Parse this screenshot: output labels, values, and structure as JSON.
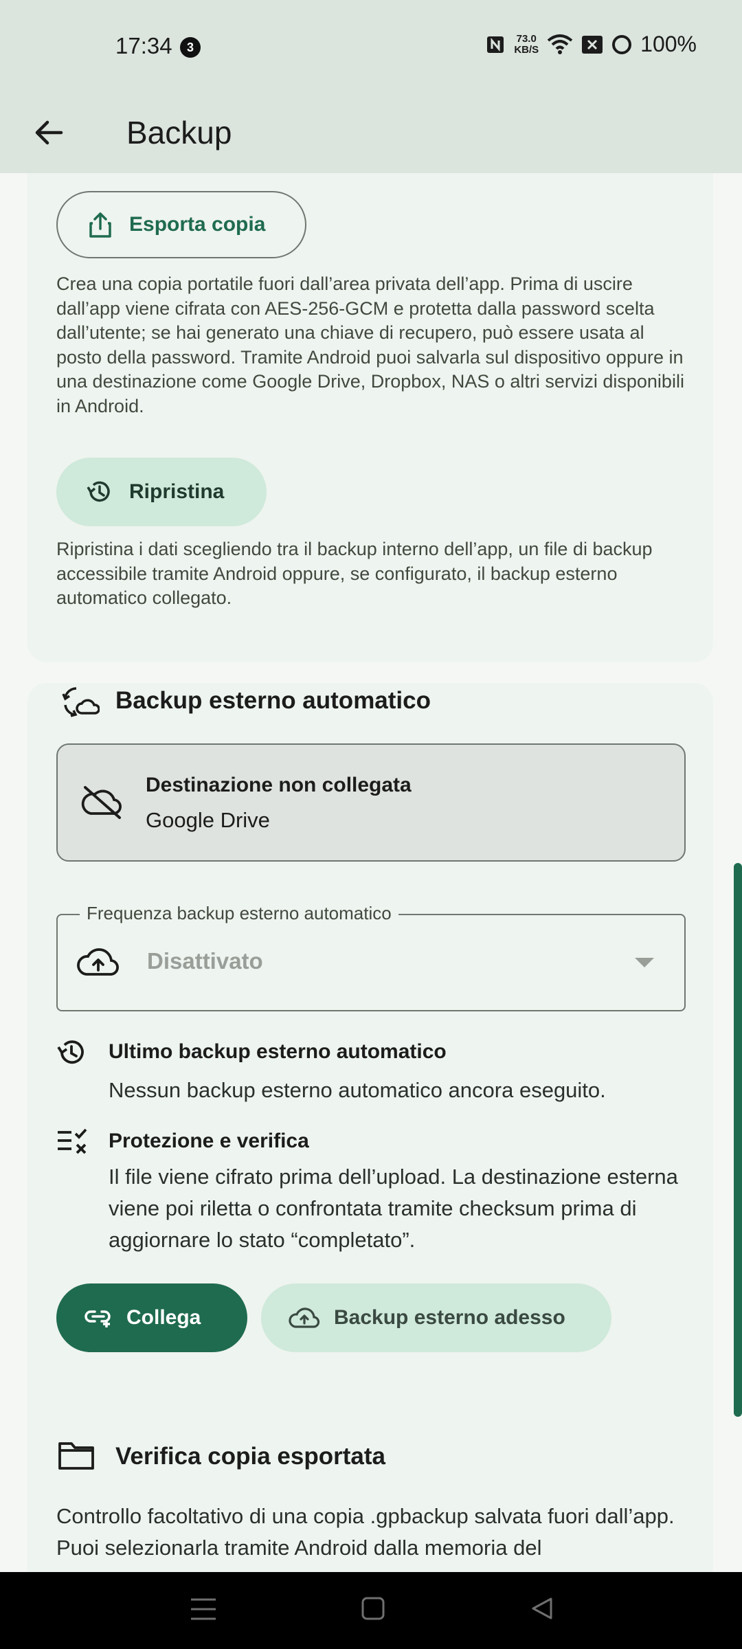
{
  "status_bar": {
    "time": "17:34",
    "notification_count": "3",
    "net_speed_value": "73.0",
    "net_speed_unit": "KB/S",
    "battery": "100%"
  },
  "app_bar": {
    "title": "Backup"
  },
  "export_section": {
    "button_label": "Esporta copia",
    "description": "Crea una copia portatile fuori dall’area privata dell’app. Prima di uscire dall’app viene cifrata con AES-256-GCM e protetta dalla password scelta dall’utente; se hai generato una chiave di recupero, può essere usata al posto della password. Tramite Android puoi salvarla sul dispositivo oppure in una destinazione come Google Drive, Dropbox, NAS o altri servizi disponibili in Android.",
    "restore_button_label": "Ripristina",
    "restore_description": "Ripristina i dati scegliendo tra il backup interno dell’app, un file di backup accessibile tramite Android oppure, se configurato, il backup esterno automatico collegato."
  },
  "auto_backup_section": {
    "title": "Backup esterno automatico",
    "destination_title": "Destinazione non collegata",
    "destination_service": "Google Drive",
    "frequency_label": "Frequenza backup esterno automatico",
    "frequency_value": "Disattivato",
    "last_backup_title": "Ultimo backup esterno automatico",
    "last_backup_text": "Nessun backup esterno automatico ancora eseguito.",
    "protection_title": "Protezione e verifica",
    "protection_text": "Il file viene cifrato prima dell’upload. La destinazione esterna viene poi riletta o confrontata tramite checksum prima di aggiornare lo stato “completato”.",
    "connect_button_label": "Collega",
    "backup_now_button_label": "Backup esterno adesso"
  },
  "verify_section": {
    "title": "Verifica copia esportata",
    "description": "Controllo facoltativo di una copia .gpbackup salvata fuori dall’app. Puoi selezionarla tramite Android dalla memoria del"
  },
  "colors": {
    "accent": "#1f6b4f",
    "tonal": "#cfe9db",
    "card": "#eef4ef",
    "app_bar": "#dce4de"
  }
}
